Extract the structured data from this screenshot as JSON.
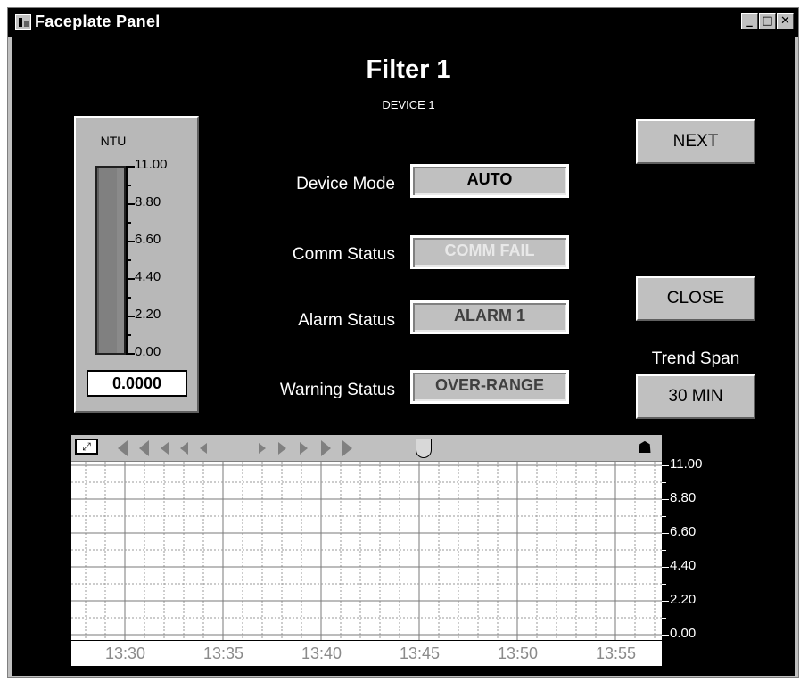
{
  "window": {
    "title": "Faceplate Panel",
    "controls": [
      "_",
      "□",
      "✕"
    ]
  },
  "panel": {
    "title": "Filter 1",
    "subtitle": "DEVICE 1"
  },
  "gauge": {
    "unit": "NTU",
    "ticks": [
      "11.00",
      "8.80",
      "6.60",
      "4.40",
      "2.20",
      "0.00"
    ],
    "readout": "0.0000",
    "value_fraction": 0.0
  },
  "status": [
    {
      "label": "Device Mode",
      "value": "AUTO",
      "color": "#000000"
    },
    {
      "label": "Comm Status",
      "value": "COMM FAIL",
      "color": "#e8e8e8"
    },
    {
      "label": "Alarm Status",
      "value": "ALARM 1",
      "color": "#404040"
    },
    {
      "label": "Warning Status",
      "value": "OVER-RANGE",
      "color": "#404040"
    }
  ],
  "buttons": {
    "next": "NEXT",
    "close": "CLOSE",
    "trend_span_label": "Trend Span",
    "trend_span_value": "30 MIN"
  },
  "trend": {
    "y_ticks": [
      "11.00",
      "8.80",
      "6.60",
      "4.40",
      "2.20",
      "0.00"
    ],
    "time_ticks": [
      "13:30",
      "13:35",
      "13:40",
      "13:45",
      "13:50",
      "13:55"
    ],
    "icons": {
      "toolbar_left": "chart-toggle-icon",
      "scroll_left": "scroll-left-icon",
      "scroll_right": "scroll-right-icon",
      "thumb": "time-cursor-icon",
      "person": "pin-icon"
    }
  }
}
